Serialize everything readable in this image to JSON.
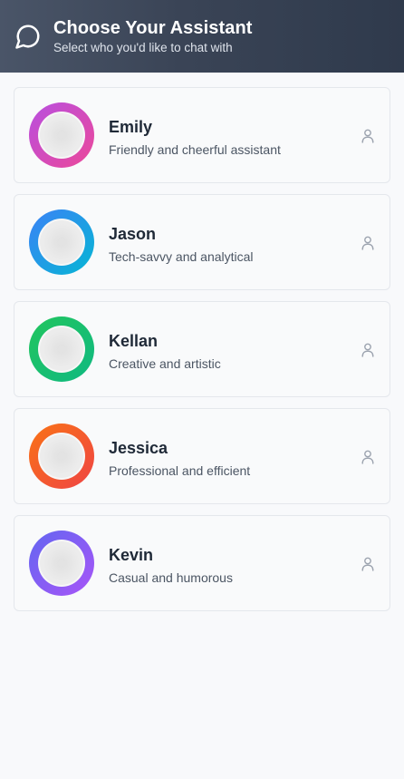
{
  "header": {
    "title": "Choose Your Assistant",
    "subtitle": "Select who you'd like to chat with",
    "icon": "chat-bubble-icon"
  },
  "assistants": [
    {
      "name": "Emily",
      "description": "Friendly and cheerful assistant",
      "ring_from": "#b84fe0",
      "ring_to": "#ec4899",
      "icon": "user-icon"
    },
    {
      "name": "Jason",
      "description": "Tech-savvy and analytical",
      "ring_from": "#3b82f6",
      "ring_to": "#06b6d4",
      "icon": "user-icon"
    },
    {
      "name": "Kellan",
      "description": "Creative and artistic",
      "ring_from": "#22c55e",
      "ring_to": "#10b981",
      "icon": "user-icon"
    },
    {
      "name": "Jessica",
      "description": "Professional and efficient",
      "ring_from": "#f97316",
      "ring_to": "#ef4444",
      "icon": "user-icon"
    },
    {
      "name": "Kevin",
      "description": "Casual and humorous",
      "ring_from": "#6366f1",
      "ring_to": "#a855f7",
      "icon": "user-icon"
    }
  ]
}
